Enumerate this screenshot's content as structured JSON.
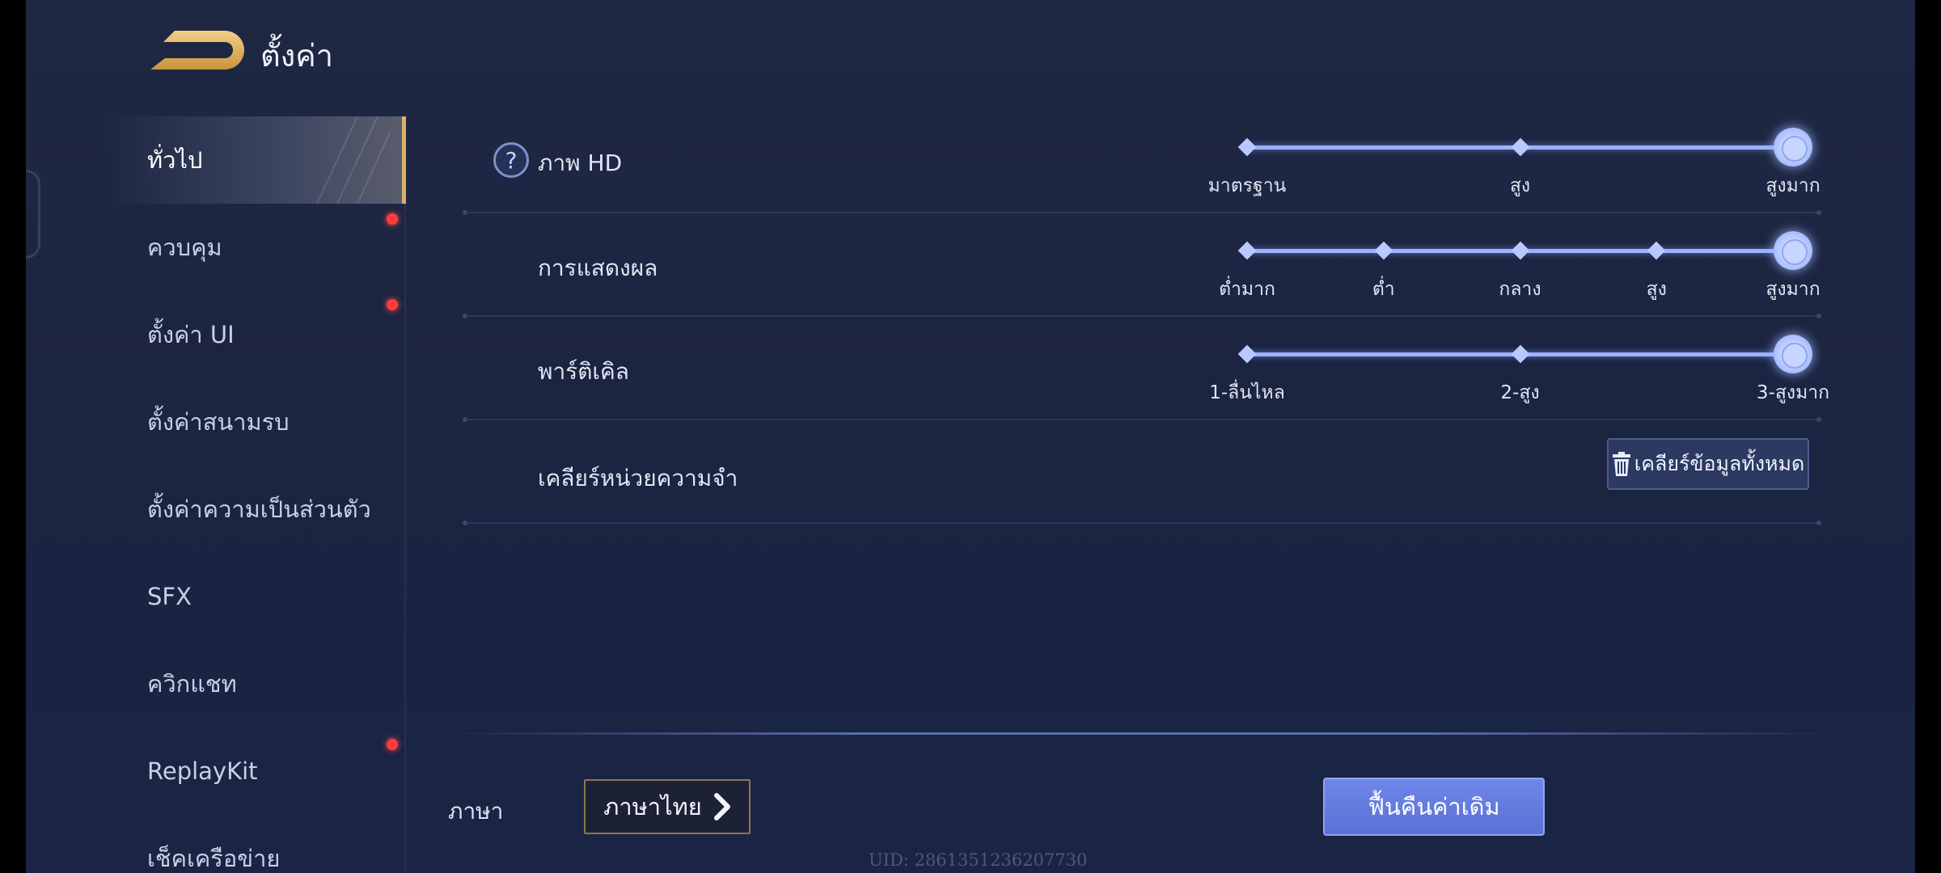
{
  "header": {
    "title": "ตั้งค่า"
  },
  "sidebar": {
    "items": [
      {
        "label": "ทั่วไป"
      },
      {
        "label": "ควบคุม"
      },
      {
        "label": "ตั้งค่า UI"
      },
      {
        "label": "ตั้งค่าสนามรบ"
      },
      {
        "label": "ตั้งค่าความเป็นส่วนตัว"
      },
      {
        "label": "SFX"
      },
      {
        "label": "ควิกแชท"
      },
      {
        "label": "ReplayKit"
      },
      {
        "label": "เช็คเครือข่าย"
      }
    ],
    "active_index": 0,
    "notification_items": [
      1,
      2,
      7
    ]
  },
  "settings": {
    "hd": {
      "label": "ภาพ HD",
      "options": [
        "มาตรฐาน",
        "สูง",
        "สูงมาก"
      ],
      "selected_index": 2
    },
    "display": {
      "label": "การแสดงผล",
      "options": [
        "ต่ำมาก",
        "ต่ำ",
        "กลาง",
        "สูง",
        "สูงมาก"
      ],
      "selected_index": 4
    },
    "particle": {
      "label": "พาร์ติเคิล",
      "options": [
        "1-ลื่นไหล",
        "2-สูง",
        "3-สูงมาก"
      ],
      "selected_index": 2
    },
    "memory": {
      "label": "เคลียร์หน่วยความจำ",
      "button_label": "เคลียร์ข้อมูลทั้งหมด"
    }
  },
  "footer": {
    "language_label": "ภาษา",
    "language_value": "ภาษาไทย",
    "reset_label": "ฟื้นคืนค่าเดิม",
    "uid": "UID: 2861351236207730"
  },
  "colors": {
    "accent_gold": "#d9b26b",
    "slider_blue": "#9bb2ff",
    "notification_red": "#ff3b3b",
    "reset_blue": "#6f86e8"
  },
  "icons": {
    "back": "back-arrow-icon",
    "help": "question-mark-icon",
    "trash": "trash-icon",
    "next": "chevron-right-icon"
  }
}
